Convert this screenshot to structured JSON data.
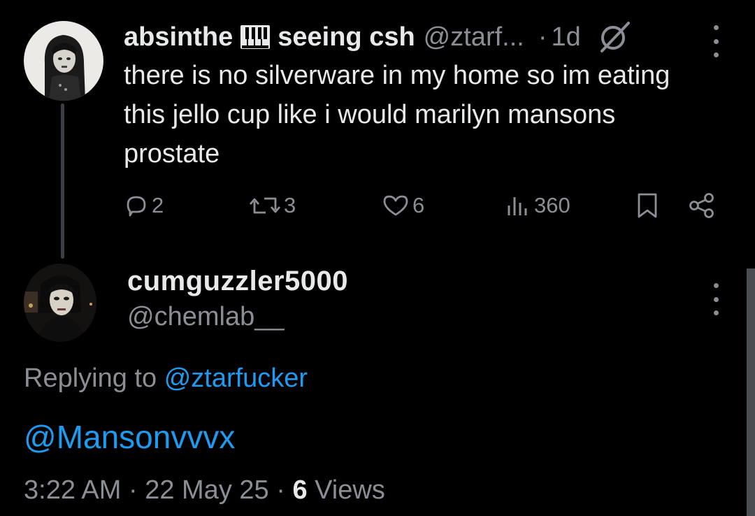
{
  "post": {
    "display_name": "absinthe",
    "name_emoji": "piano-keys-emoji",
    "name_suffix": "seeing csh",
    "handle": "@ztarf...",
    "separator": "·",
    "time_ago": "1d",
    "text": "there is no silverware in my home so im eating this jello cup like i would marilyn mansons prostate",
    "actions": {
      "replies": "2",
      "retweets": "3",
      "likes": "6",
      "views": "360"
    }
  },
  "reply": {
    "display_name": "cumguzzler5000",
    "handle": "@chemlab__",
    "replying_prefix": "Replying to",
    "replying_to": "@ztarfucker",
    "text": "@Mansonvvvx",
    "time": "3:22 AM",
    "separator_1": "·",
    "date": "22 May 25",
    "separator_2": "·",
    "views_count": "6",
    "views_label": "Views"
  },
  "colors": {
    "background": "#000000",
    "text_primary": "#e7e9ea",
    "text_secondary": "#8b8f95",
    "link": "#1d9bf0",
    "thread_line": "#3b3f44"
  }
}
